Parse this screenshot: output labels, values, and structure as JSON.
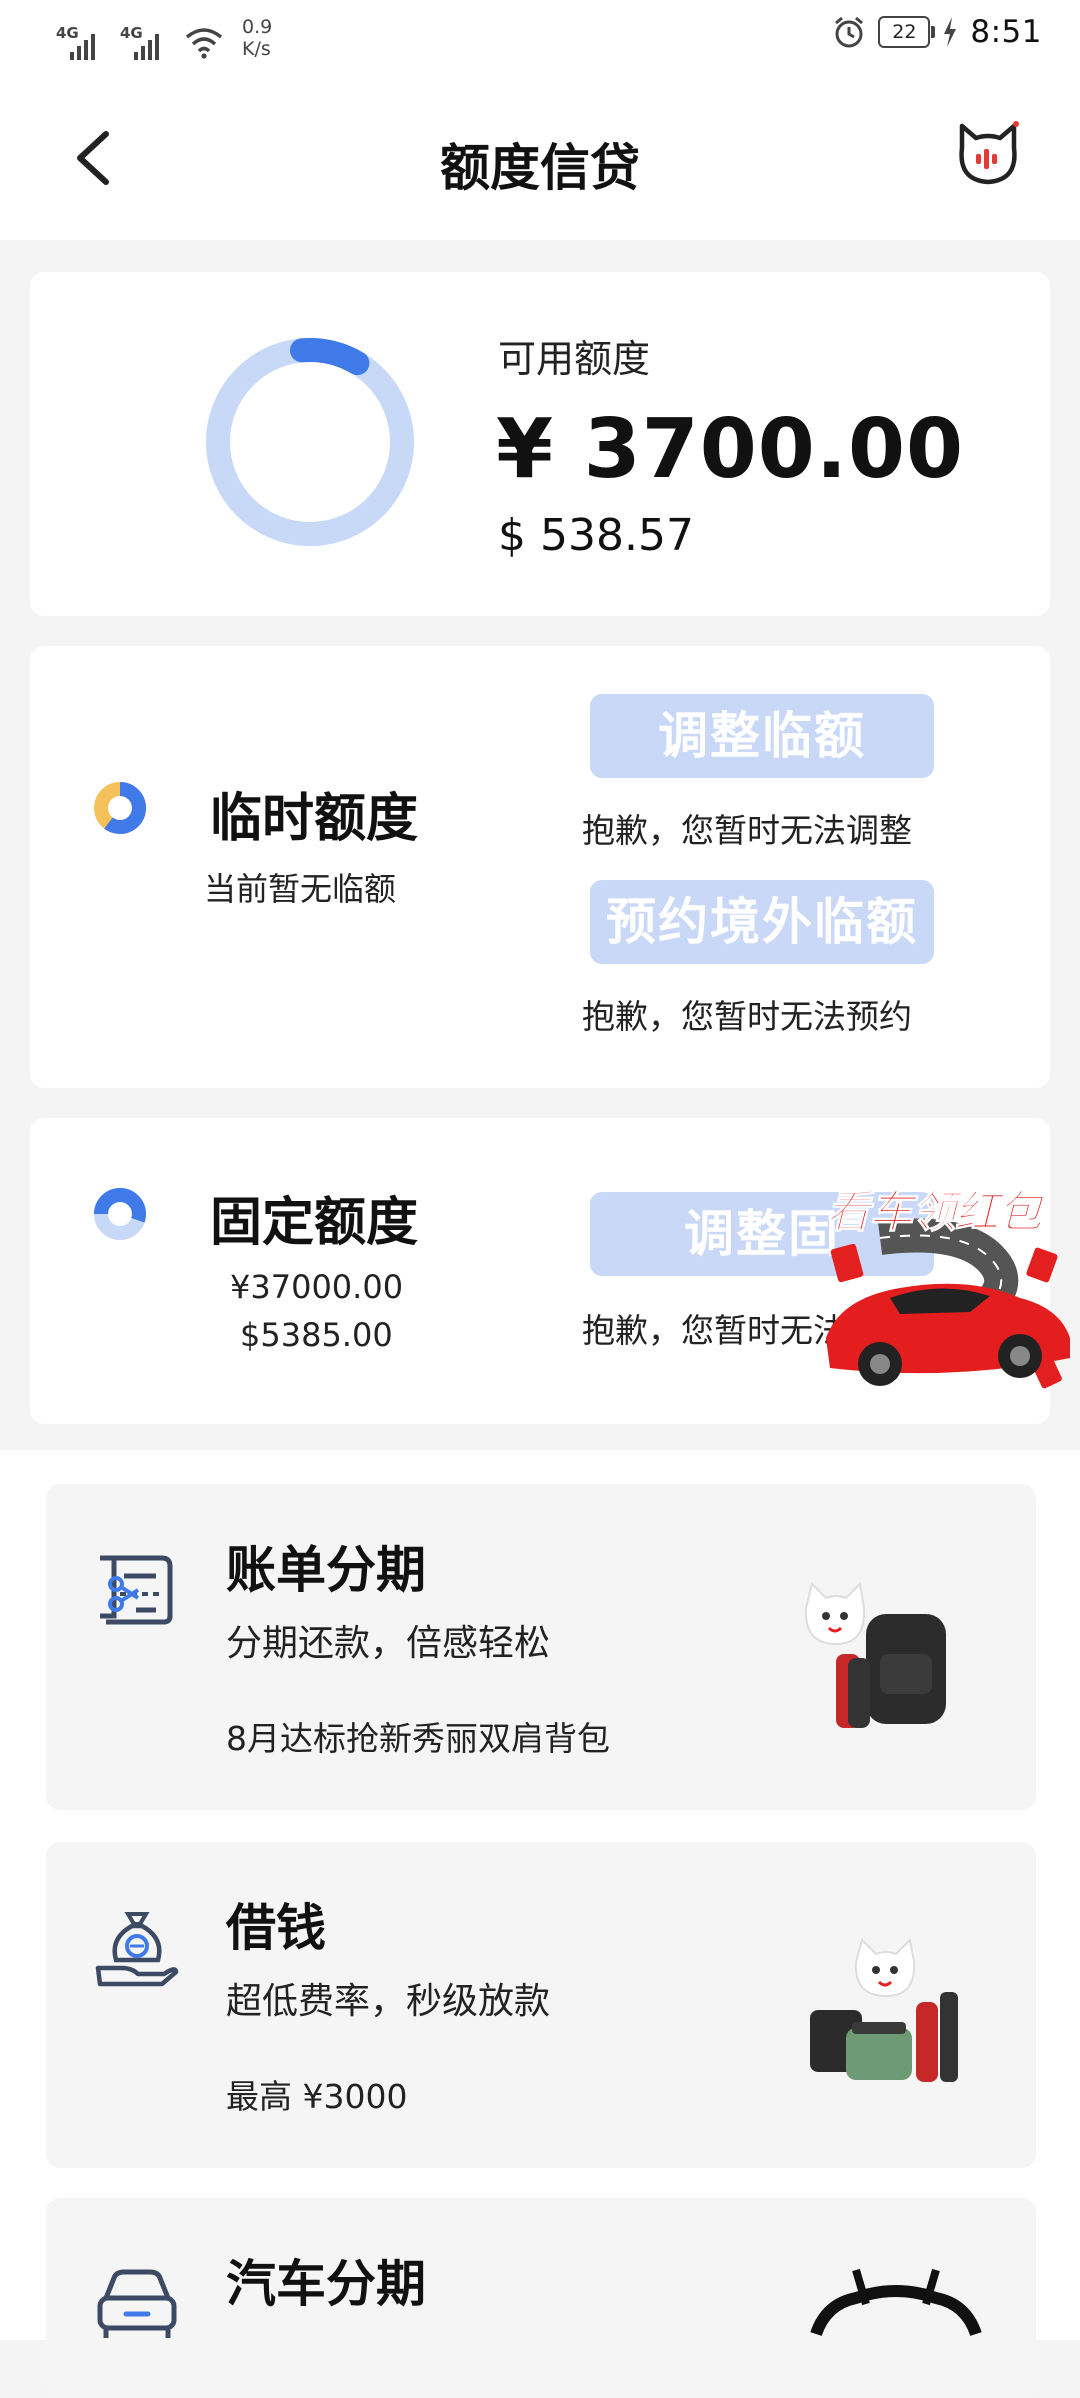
{
  "status_bar": {
    "signal1_label": "4G",
    "signal2_label": "4G",
    "speed_value": "0.9",
    "speed_unit": "K/s",
    "battery": "22",
    "time": "8:51"
  },
  "header": {
    "title": "额度信贷",
    "back_icon": "chevron-left-icon",
    "assistant_icon": "cat-mascot-icon"
  },
  "available": {
    "label": "可用额度",
    "cny": "¥ 3700.00",
    "usd": "$ 538.57",
    "used_fraction": 0.1
  },
  "temporary": {
    "title": "临时额度",
    "subtitle": "当前暂无临额",
    "adjust_button": "调整临额",
    "adjust_note": "抱歉，您暂时无法调整",
    "overseas_button": "预约境外临额",
    "overseas_note": "抱歉，您暂时无法预约"
  },
  "fixed": {
    "title": "固定额度",
    "cny": "¥37000.00",
    "usd": "$5385.00",
    "adjust_button": "调整固",
    "adjust_note": "抱歉，您暂时无法"
  },
  "ad": {
    "text": "看车领红包"
  },
  "services": [
    {
      "title": "账单分期",
      "subtitle": "分期还款，倍感轻松",
      "promo": "8月达标抢新秀丽双肩背包"
    },
    {
      "title": "借钱",
      "subtitle": "超低费率，秒级放款",
      "promo": "最高 ¥3000"
    },
    {
      "title": "汽车分期"
    }
  ],
  "colors": {
    "accent": "#3f7ae8",
    "ring_bg": "#c8d9f8",
    "button_disabled": "#c9d8f7",
    "ad_red": "#e31f1f"
  }
}
